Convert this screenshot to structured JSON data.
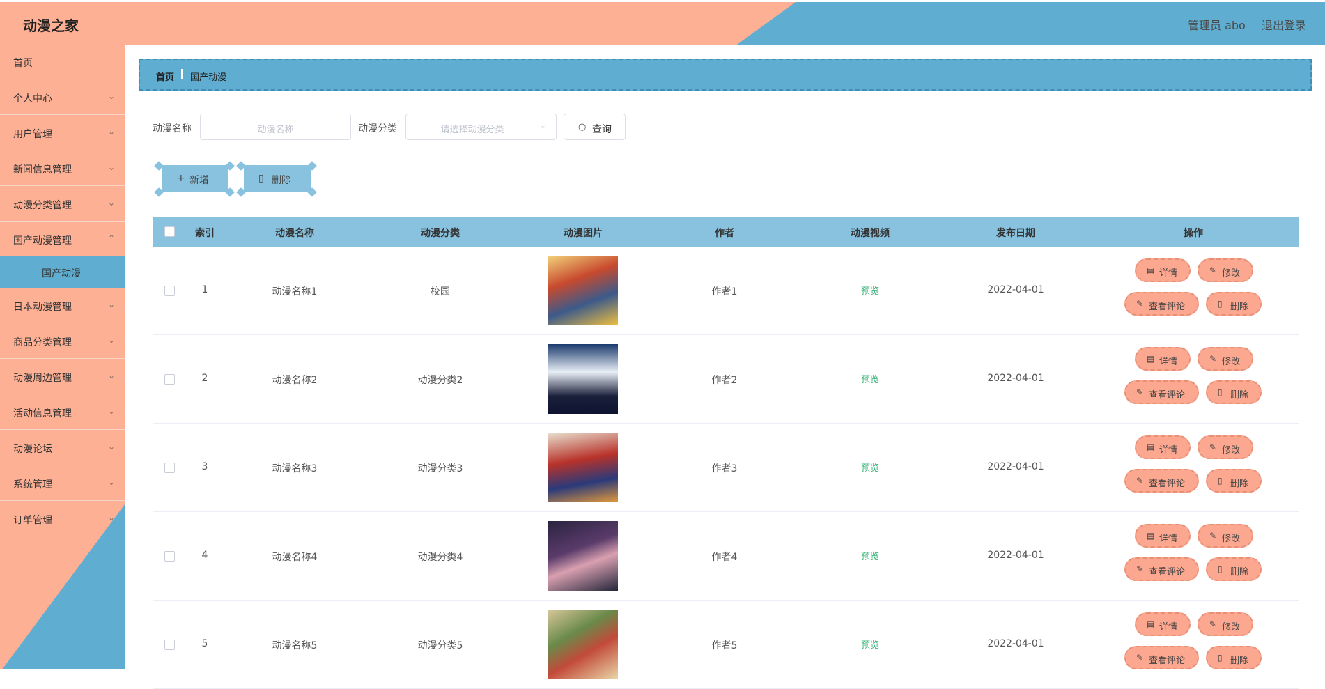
{
  "app": {
    "title": "动漫之家"
  },
  "header": {
    "user": "管理员 abo",
    "logout": "退出登录"
  },
  "sidebar": {
    "items": [
      {
        "label": "首页",
        "chevron": false
      },
      {
        "label": "个人中心",
        "chevron": true
      },
      {
        "label": "用户管理",
        "chevron": true
      },
      {
        "label": "新闻信息管理",
        "chevron": true
      },
      {
        "label": "动漫分类管理",
        "chevron": true
      },
      {
        "label": "国产动漫管理",
        "chevron": true,
        "expanded": true
      },
      {
        "label": "日本动漫管理",
        "chevron": true
      },
      {
        "label": "商品分类管理",
        "chevron": true
      },
      {
        "label": "动漫周边管理",
        "chevron": true
      },
      {
        "label": "活动信息管理",
        "chevron": true
      },
      {
        "label": "动漫论坛",
        "chevron": true
      },
      {
        "label": "系统管理",
        "chevron": true
      },
      {
        "label": "订单管理",
        "chevron": true
      }
    ],
    "submenu_active": "国产动漫"
  },
  "breadcrumb": {
    "home": "首页",
    "current": "国产动漫"
  },
  "search": {
    "name_label": "动漫名称",
    "name_placeholder": "动漫名称",
    "category_label": "动漫分类",
    "category_placeholder": "请选择动漫分类",
    "query_button": "查询"
  },
  "actions": {
    "add": "新增",
    "delete": "删除"
  },
  "table": {
    "headers": [
      "索引",
      "动漫名称",
      "动漫分类",
      "动漫图片",
      "作者",
      "动漫视频",
      "发布日期",
      "操作"
    ],
    "row_buttons": {
      "detail": "详情",
      "edit": "修改",
      "comments": "查看评论",
      "delete": "删除"
    },
    "rows": [
      {
        "index": "1",
        "name": "动漫名称1",
        "category": "校园",
        "author": "作者1",
        "video": "预览",
        "date": "2022-04-01"
      },
      {
        "index": "2",
        "name": "动漫名称2",
        "category": "动漫分类2",
        "author": "作者2",
        "video": "预览",
        "date": "2022-04-01"
      },
      {
        "index": "3",
        "name": "动漫名称3",
        "category": "动漫分类3",
        "author": "作者3",
        "video": "预览",
        "date": "2022-04-01"
      },
      {
        "index": "4",
        "name": "动漫名称4",
        "category": "动漫分类4",
        "author": "作者4",
        "video": "预览",
        "date": "2022-04-01"
      },
      {
        "index": "5",
        "name": "动漫名称5",
        "category": "动漫分类5",
        "author": "作者5",
        "video": "预览",
        "date": "2022-04-01"
      }
    ]
  },
  "colors": {
    "salmon": "#fdb094",
    "blue": "#5fadd0",
    "light_blue": "#89c2de",
    "button_salmon": "#fca78f",
    "preview_green": "#3fb57c"
  }
}
